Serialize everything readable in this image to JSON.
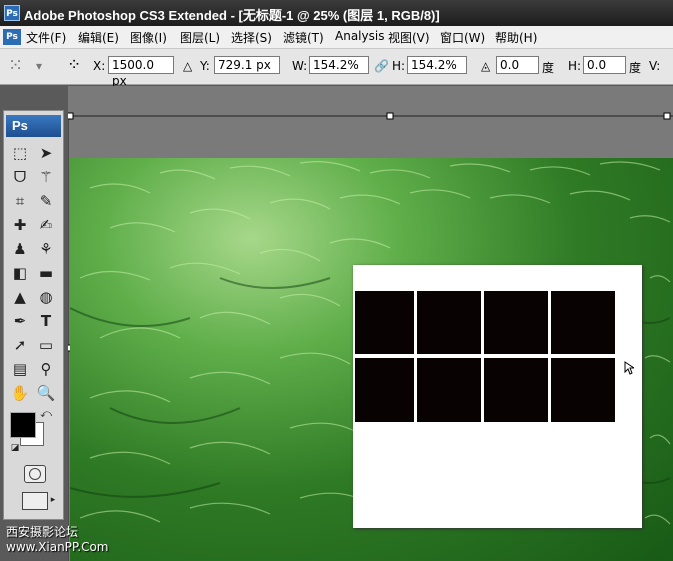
{
  "window": {
    "title": "Adobe Photoshop CS3 Extended - [无标题-1 @ 25% (图层 1, RGB/8)]",
    "logo": "Ps"
  },
  "menu": [
    {
      "label": "文件(F)"
    },
    {
      "label": "编辑(E)"
    },
    {
      "label": "图像(I)"
    },
    {
      "label": "图层(L)"
    },
    {
      "label": "选择(S)"
    },
    {
      "label": "滤镜(T)"
    },
    {
      "label": "Analysis"
    },
    {
      "label": "视图(V)"
    },
    {
      "label": "窗口(W)"
    },
    {
      "label": "帮助(H)"
    }
  ],
  "options": {
    "x_label": "X:",
    "x_value": "1500.0 px",
    "y_label": "Y:",
    "y_value": "729.1 px",
    "w_label": "W:",
    "w_value": "154.2%",
    "h_label": "H:",
    "h_value": "154.2%",
    "angle_value": "0.0",
    "angle_unit": "度",
    "hskew_label": "H:",
    "hskew_value": "0.0",
    "hskew_unit": "度",
    "vskew_label": "V:"
  },
  "toolbox": {
    "logo": "Ps"
  },
  "watermark": {
    "line1": "西安摄影论坛",
    "line2": "www.XianPP.Com"
  },
  "colors": {
    "foreground": "#000000",
    "background": "#ffffff"
  }
}
